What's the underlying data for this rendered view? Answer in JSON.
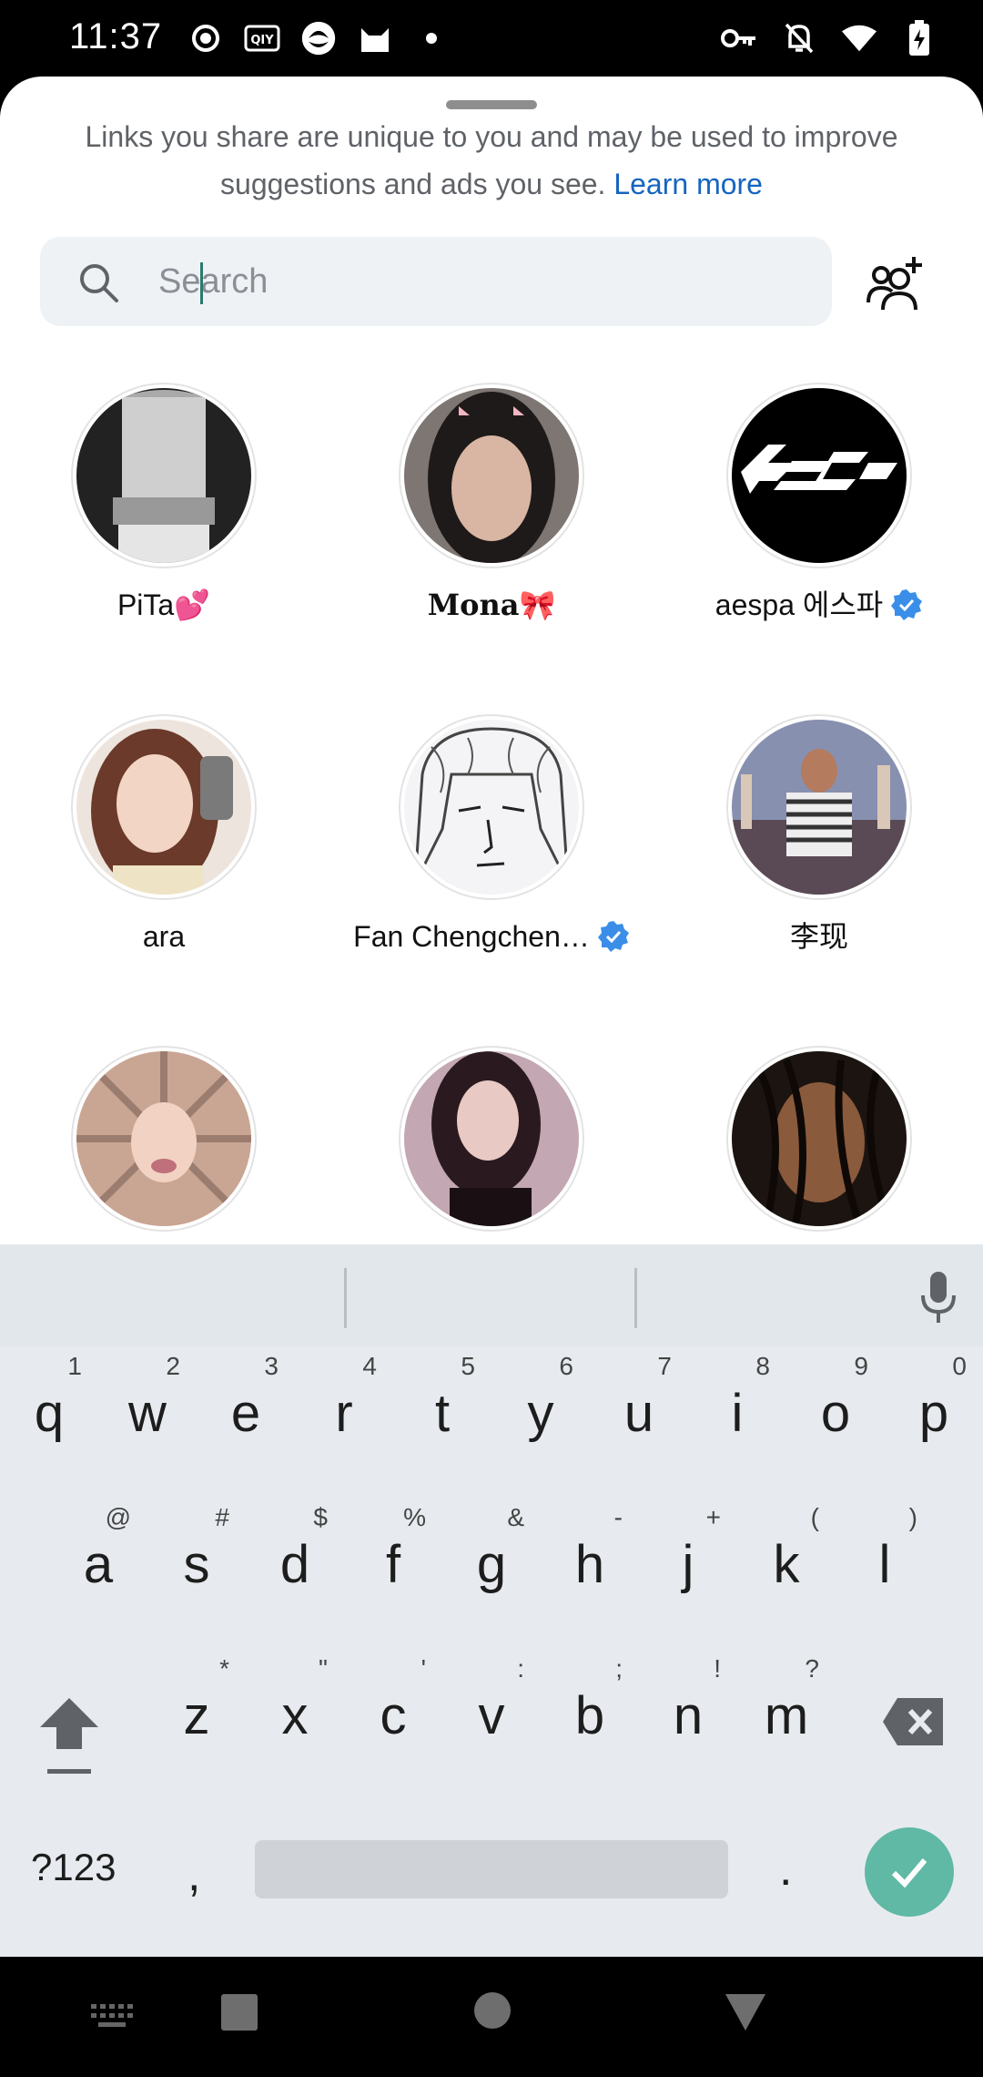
{
  "status_bar": {
    "time": "11:37",
    "left_icons": [
      "record-icon",
      "iqiyi-icon",
      "app-icon",
      "cat-app-icon",
      "dot-icon"
    ],
    "right_icons": [
      "vpn-key-icon",
      "mute-icon",
      "wifi-icon",
      "battery-charging-icon"
    ]
  },
  "share_sheet": {
    "notice_text": "Links you share are unique to you and may be used to improve suggestions and ads you see.",
    "learn_more": "Learn more",
    "search_placeholder": "Search",
    "contacts": [
      {
        "name": "PiTa💕",
        "verified": false
      },
      {
        "name": "Mona🎀",
        "verified": false
      },
      {
        "name": "aespa 에스파",
        "verified": true
      },
      {
        "name": "ara",
        "verified": false
      },
      {
        "name": "Fan Chengchen…",
        "verified": true
      },
      {
        "name": "李现",
        "verified": false
      },
      {
        "name": "",
        "verified": false
      },
      {
        "name": "",
        "verified": false
      },
      {
        "name": "",
        "verified": false
      }
    ]
  },
  "keyboard": {
    "row1": [
      {
        "key": "q",
        "hint": "1"
      },
      {
        "key": "w",
        "hint": "2"
      },
      {
        "key": "e",
        "hint": "3"
      },
      {
        "key": "r",
        "hint": "4"
      },
      {
        "key": "t",
        "hint": "5"
      },
      {
        "key": "y",
        "hint": "6"
      },
      {
        "key": "u",
        "hint": "7"
      },
      {
        "key": "i",
        "hint": "8"
      },
      {
        "key": "o",
        "hint": "9"
      },
      {
        "key": "p",
        "hint": "0"
      }
    ],
    "row2": [
      {
        "key": "a",
        "hint": "@"
      },
      {
        "key": "s",
        "hint": "#"
      },
      {
        "key": "d",
        "hint": "$"
      },
      {
        "key": "f",
        "hint": "%"
      },
      {
        "key": "g",
        "hint": "&"
      },
      {
        "key": "h",
        "hint": "-"
      },
      {
        "key": "j",
        "hint": "+"
      },
      {
        "key": "k",
        "hint": "("
      },
      {
        "key": "l",
        "hint": ")"
      }
    ],
    "row3": [
      {
        "key": "z",
        "hint": "*"
      },
      {
        "key": "x",
        "hint": "\""
      },
      {
        "key": "c",
        "hint": "'"
      },
      {
        "key": "v",
        "hint": ":"
      },
      {
        "key": "b",
        "hint": ";"
      },
      {
        "key": "n",
        "hint": "!"
      },
      {
        "key": "m",
        "hint": "?"
      }
    ],
    "symbols_label": "?123",
    "comma": ",",
    "period": "."
  },
  "colors": {
    "link": "#1565c0",
    "verified": "#3b8ee8",
    "enter_key": "#5fb9a4"
  }
}
